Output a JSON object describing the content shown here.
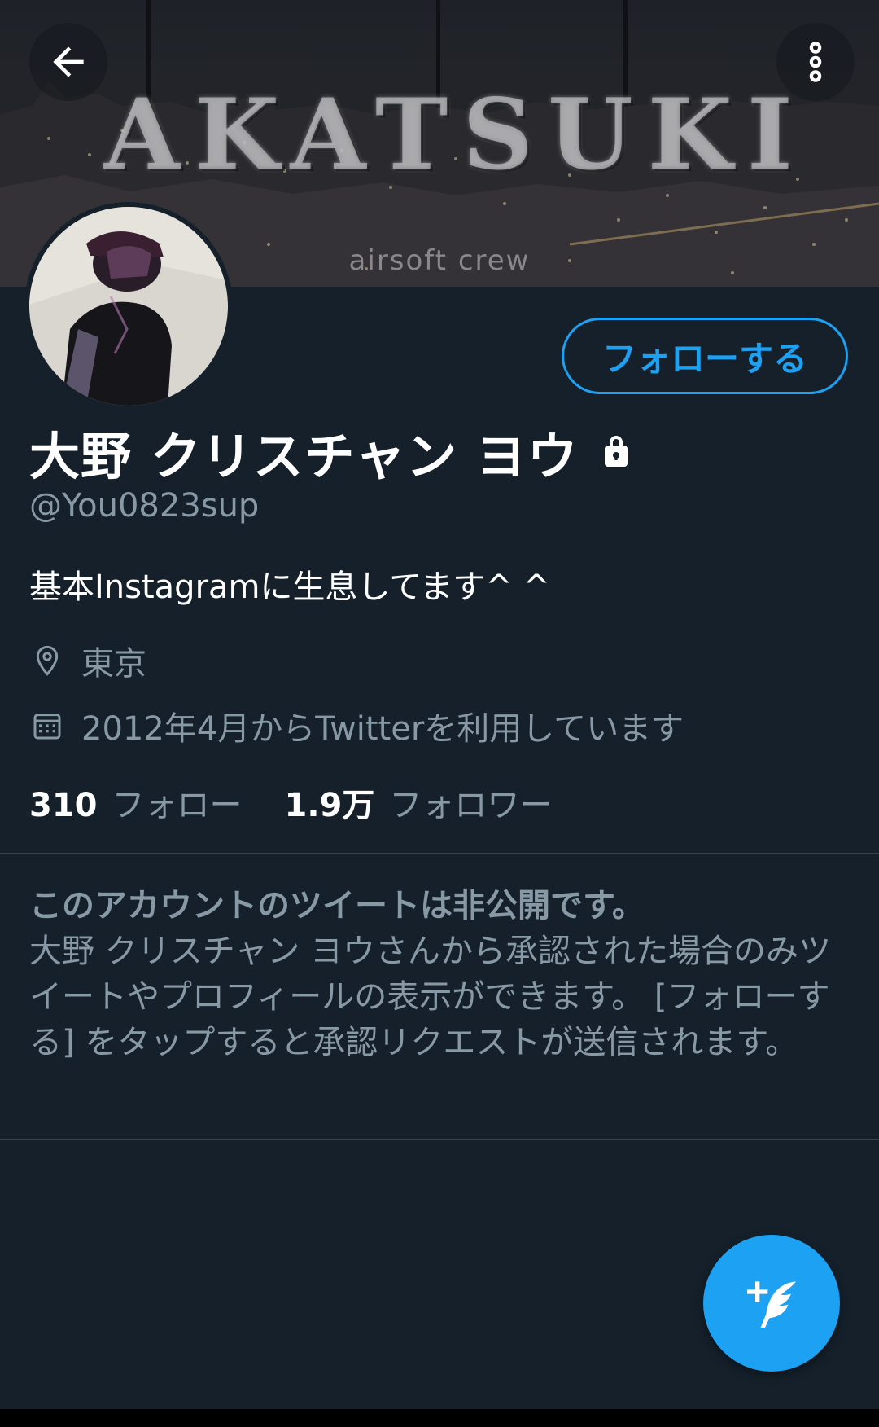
{
  "banner": {
    "title_text": "AKATSUKI",
    "subtitle_text": "airsoft crew"
  },
  "header": {
    "back_icon": "arrow-left-icon",
    "more_icon": "more-vertical-icon"
  },
  "profile": {
    "display_name": "大野 クリスチャン ヨウ",
    "handle": "@You0823sup",
    "bio": "基本Instagramに生息してます^ ^",
    "location": "東京",
    "joined": "2012年4月からTwitterを利用しています",
    "following_count": "310",
    "following_label": "フォロー",
    "followers_count": "1.9万",
    "followers_label": "フォロワー",
    "follow_button_label": "フォローする",
    "protected": true
  },
  "private_notice": {
    "title": "このアカウントのツイートは非公開です。",
    "body": "大野 クリスチャン ヨウさんから承認された場合のみツイートやプロフィールの表示ができます。 [フォローする] をタップすると承認リクエストが送信されます。"
  },
  "fab": {
    "icon": "compose-tweet-icon"
  },
  "colors": {
    "background": "#15202b",
    "accent": "#1da1f2",
    "secondary_text": "#8899a6",
    "divider": "#38444d"
  }
}
